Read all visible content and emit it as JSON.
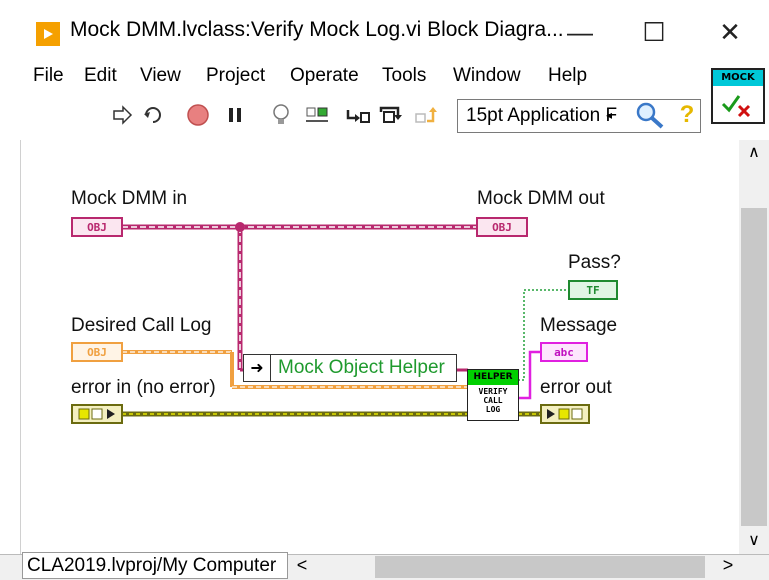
{
  "window": {
    "title": "Mock DMM.lvclass:Verify Mock Log.vi Block Diagra...",
    "minimize_glyph": "—",
    "maximize_glyph": "☐",
    "close_glyph": "✕"
  },
  "menu": [
    "File",
    "Edit",
    "View",
    "Project",
    "Operate",
    "Tools",
    "Window",
    "Help"
  ],
  "toolbar": {
    "font_select_value": "15pt Application F",
    "icons": [
      "run-arrow-icon",
      "run-continuously-icon",
      "abort-icon",
      "pause-icon",
      "highlight-execution-icon",
      "retain-wire-values-icon",
      "step-into-icon",
      "step-over-icon",
      "step-out-icon",
      "search-icon",
      "help-icon"
    ]
  },
  "vi_icon": {
    "label": "MOCK"
  },
  "diagram": {
    "controls": [
      {
        "label": "Mock DMM in",
        "terminal": "OBJ"
      },
      {
        "label": "Desired Call Log",
        "terminal": "OBJ"
      },
      {
        "label": "error in (no error)",
        "terminal": ""
      }
    ],
    "indicators": [
      {
        "label": "Mock DMM out",
        "terminal": "OBJ"
      },
      {
        "label": "Pass?",
        "terminal": "TF"
      },
      {
        "label": "Message",
        "terminal": "abc"
      },
      {
        "label": "error out",
        "terminal": ""
      }
    ],
    "constant_label": "Mock Object Helper",
    "subvi": {
      "header": "HELPER",
      "line1": "VERIFY",
      "line2": "CALL",
      "line3": "LOG"
    }
  },
  "status": {
    "path": "CLA2019.lvproj/My Computer"
  },
  "colors": {
    "class_wire": "#b8286e",
    "orange_wire": "#f0a040",
    "error_wire": "#6b6b10",
    "bool_wire": "#22a03a",
    "string_wire": "#e020e0"
  }
}
